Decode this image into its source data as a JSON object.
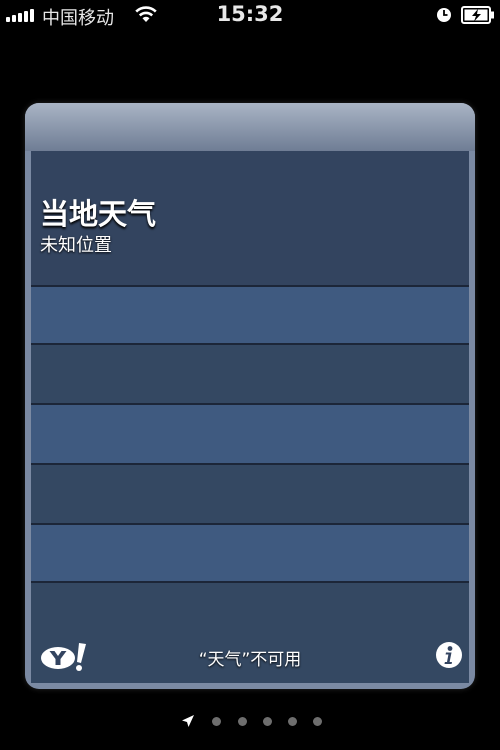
{
  "status_bar": {
    "carrier": "中国移动",
    "time": "15:32",
    "icons": [
      "signal-bars-icon",
      "wifi-icon",
      "alarm-clock-icon",
      "battery-charging-icon"
    ]
  },
  "widget": {
    "location_title": "当地天气",
    "location_subtitle": "未知位置",
    "footer_text": "“天气”不可用",
    "icons": [
      "yahoo-logo",
      "info-icon"
    ],
    "colors": {
      "light_stripe": "#3f5a80",
      "dark_stripe": "#344862",
      "frame": "#7b8aa3"
    }
  },
  "page_indicator": {
    "icons": [
      "location-arrow-icon"
    ],
    "dot_count": 5
  }
}
